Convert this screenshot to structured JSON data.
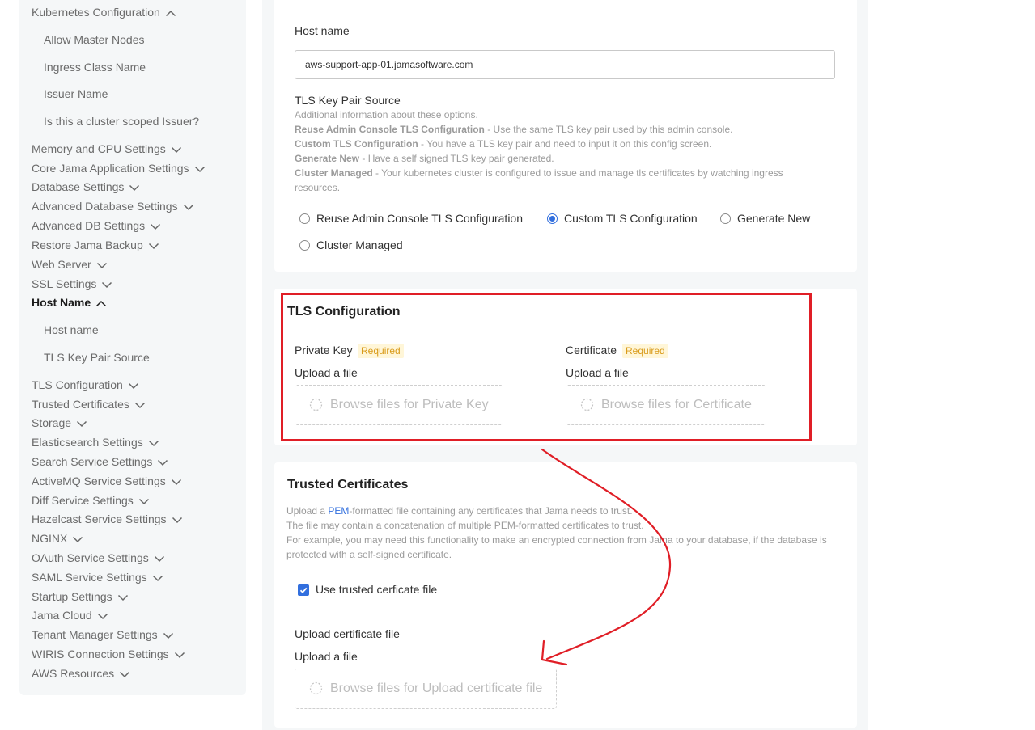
{
  "sidebar": {
    "items": [
      {
        "label": "Kubernetes Configuration",
        "chevron": "up"
      },
      {
        "label": "Allow Master Nodes",
        "sub": true
      },
      {
        "label": "Ingress Class Name",
        "sub": true
      },
      {
        "label": "Issuer Name",
        "sub": true
      },
      {
        "label": "Is this a cluster scoped Issuer?",
        "sub": true
      },
      {
        "label": "Memory and CPU Settings",
        "chevron": "down"
      },
      {
        "label": "Core Jama Application Settings",
        "chevron": "down"
      },
      {
        "label": "Database Settings",
        "chevron": "down"
      },
      {
        "label": "Advanced Database Settings",
        "chevron": "down"
      },
      {
        "label": "Advanced DB Settings",
        "chevron": "down"
      },
      {
        "label": "Restore Jama Backup",
        "chevron": "down"
      },
      {
        "label": "Web Server",
        "chevron": "down"
      },
      {
        "label": "SSL Settings",
        "chevron": "down"
      },
      {
        "label": "Host Name",
        "chevron": "up",
        "active": true
      },
      {
        "label": "Host name",
        "sub": true
      },
      {
        "label": "TLS Key Pair Source",
        "sub": true
      },
      {
        "label": "TLS Configuration",
        "chevron": "down"
      },
      {
        "label": "Trusted Certificates",
        "chevron": "down"
      },
      {
        "label": "Storage",
        "chevron": "down"
      },
      {
        "label": "Elasticsearch Settings",
        "chevron": "down"
      },
      {
        "label": "Search Service Settings",
        "chevron": "down"
      },
      {
        "label": "ActiveMQ Service Settings",
        "chevron": "down"
      },
      {
        "label": "Diff Service Settings",
        "chevron": "down"
      },
      {
        "label": "Hazelcast Service Settings",
        "chevron": "down"
      },
      {
        "label": "NGINX",
        "chevron": "down"
      },
      {
        "label": "OAuth Service Settings",
        "chevron": "down"
      },
      {
        "label": "SAML Service Settings",
        "chevron": "down"
      },
      {
        "label": "Startup Settings",
        "chevron": "down"
      },
      {
        "label": "Jama Cloud",
        "chevron": "down"
      },
      {
        "label": "Tenant Manager Settings",
        "chevron": "down"
      },
      {
        "label": "WIRIS Connection Settings",
        "chevron": "down"
      },
      {
        "label": "AWS Resources",
        "chevron": "down"
      }
    ]
  },
  "host": {
    "label": "Host name",
    "value": "aws-support-app-01.jamasoftware.com"
  },
  "tls_source": {
    "label": "TLS Key Pair Source",
    "help_intro": "Additional information about these options.",
    "help_lines": [
      {
        "bold": "Reuse Admin Console TLS Configuration",
        "text": " - Use the same TLS key pair used by this admin console."
      },
      {
        "bold": "Custom TLS Configuration",
        "text": " - You have a TLS key pair and need to input it on this config screen."
      },
      {
        "bold": "Generate New",
        "text": " - Have a self signed TLS key pair generated."
      },
      {
        "bold": "Cluster Managed",
        "text": " - Your kubernetes cluster is configured to issue and manage tls certificates by watching ingress resources."
      }
    ],
    "options": [
      {
        "label": "Reuse Admin Console TLS Configuration",
        "checked": false
      },
      {
        "label": "Custom TLS Configuration",
        "checked": true
      },
      {
        "label": "Generate New",
        "checked": false
      },
      {
        "label": "Cluster Managed",
        "checked": false
      }
    ]
  },
  "tls_config": {
    "title": "TLS Configuration",
    "private_key": {
      "label": "Private Key",
      "badge": "Required",
      "upload_label": "Upload a file",
      "browse": "Browse files for Private Key"
    },
    "certificate": {
      "label": "Certificate",
      "badge": "Required",
      "upload_label": "Upload a file",
      "browse": "Browse files for Certificate"
    }
  },
  "trusted": {
    "title": "Trusted Certificates",
    "help_pre": "Upload a ",
    "help_link": "PEM",
    "help_post": "-formatted file containing any certificates that Jama needs to trust.",
    "help_line2": "The file may contain a concatenation of multiple PEM-formatted certificates to trust.",
    "help_line3": "For example, you may need this functionality to make an encrypted connection from Jama to your database, if the database is protected with a self-signed certificate.",
    "checkbox_label": "Use trusted cerficate file",
    "checkbox_checked": true,
    "upload_title": "Upload certificate file",
    "upload_label": "Upload a file",
    "browse": "Browse files for Upload certificate file"
  },
  "colors": {
    "accent": "#326fde",
    "annotation": "#e01e26",
    "badge_text": "#d99b1a",
    "badge_bg": "#fff6d8"
  }
}
